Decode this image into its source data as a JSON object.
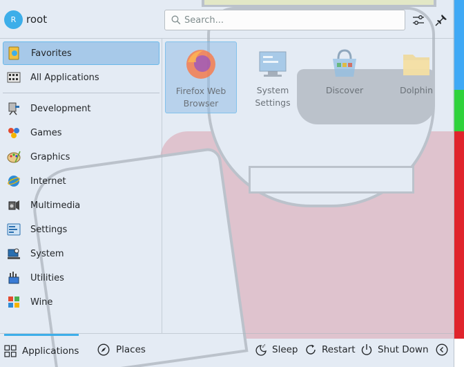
{
  "user": {
    "initial": "R",
    "name": "root"
  },
  "search": {
    "placeholder": "Search..."
  },
  "categories": [
    {
      "label": "Favorites",
      "icon": "favorites-icon",
      "selected": true
    },
    {
      "label": "All Applications",
      "icon": "all-applications-icon"
    },
    {
      "label": "Development",
      "icon": "development-icon"
    },
    {
      "label": "Games",
      "icon": "games-icon"
    },
    {
      "label": "Graphics",
      "icon": "graphics-icon"
    },
    {
      "label": "Internet",
      "icon": "internet-icon"
    },
    {
      "label": "Multimedia",
      "icon": "multimedia-icon"
    },
    {
      "label": "Settings",
      "icon": "settings-icon"
    },
    {
      "label": "System",
      "icon": "system-icon"
    },
    {
      "label": "Utilities",
      "icon": "utilities-icon"
    },
    {
      "label": "Wine",
      "icon": "wine-icon"
    }
  ],
  "favorites": [
    {
      "label": "Firefox Web Browser",
      "icon": "firefox-icon",
      "selected": true
    },
    {
      "label": "System Settings",
      "icon": "system-settings-icon"
    },
    {
      "label": "Discover",
      "icon": "discover-icon"
    },
    {
      "label": "Dolphin",
      "icon": "dolphin-icon"
    }
  ],
  "footer": {
    "applications": "Applications",
    "places": "Places",
    "sleep": "Sleep",
    "restart": "Restart",
    "shutdown": "Shut Down"
  },
  "colors": {
    "accent": "#3daee9",
    "selection": "#93bee6"
  }
}
